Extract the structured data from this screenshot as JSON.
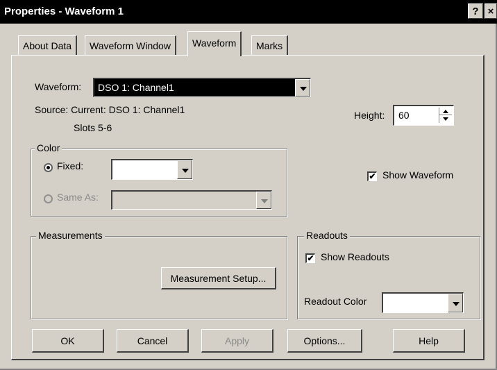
{
  "window": {
    "title": "Properties - Waveform 1",
    "help_glyph": "?",
    "close_glyph": "×"
  },
  "tabs": [
    {
      "label": "About Data",
      "active": false
    },
    {
      "label": "Waveform Window",
      "active": false
    },
    {
      "label": "Waveform",
      "active": true
    },
    {
      "label": "Marks",
      "active": false
    }
  ],
  "waveform": {
    "label": "Waveform:",
    "selected": "DSO 1: Channel1",
    "source_label": "Source: Current: DSO 1: Channel1",
    "slots": "Slots 5-6"
  },
  "height": {
    "label": "Height:",
    "value": "60"
  },
  "color": {
    "group_label": "Color",
    "fixed_label": "Fixed:",
    "fixed_selected": true,
    "same_as_label": "Same As:",
    "same_as_enabled": false,
    "fixed_color": "#ffffff"
  },
  "show_waveform": {
    "label": "Show Waveform",
    "checked": true,
    "check_glyph": "✔"
  },
  "measurements": {
    "group_label": "Measurements",
    "setup_button": "Measurement Setup..."
  },
  "readouts": {
    "group_label": "Readouts",
    "show_label": "Show Readouts",
    "show_checked": true,
    "color_label": "Readout Color",
    "readout_color": "#ffffff"
  },
  "buttons": {
    "ok": "OK",
    "cancel": "Cancel",
    "apply": "Apply",
    "options": "Options...",
    "help": "Help"
  },
  "colors": {
    "face": "#d4d0c8",
    "titlebar": "#000000",
    "combo_highlight": "#000000",
    "disabled_text": "#8a8a8a"
  }
}
